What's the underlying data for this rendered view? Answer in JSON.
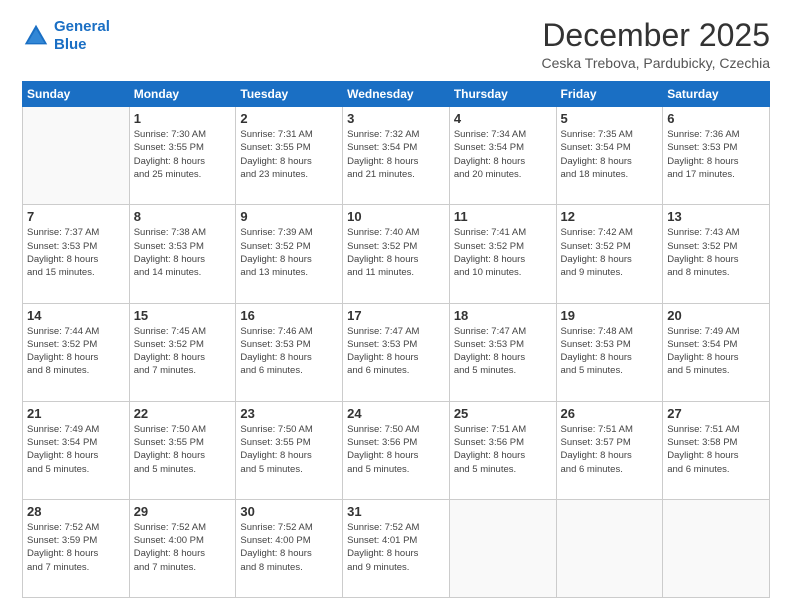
{
  "logo": {
    "line1": "General",
    "line2": "Blue"
  },
  "title": "December 2025",
  "subtitle": "Ceska Trebova, Pardubicky, Czechia",
  "weekdays": [
    "Sunday",
    "Monday",
    "Tuesday",
    "Wednesday",
    "Thursday",
    "Friday",
    "Saturday"
  ],
  "weeks": [
    [
      {
        "day": "",
        "info": ""
      },
      {
        "day": "1",
        "info": "Sunrise: 7:30 AM\nSunset: 3:55 PM\nDaylight: 8 hours\nand 25 minutes."
      },
      {
        "day": "2",
        "info": "Sunrise: 7:31 AM\nSunset: 3:55 PM\nDaylight: 8 hours\nand 23 minutes."
      },
      {
        "day": "3",
        "info": "Sunrise: 7:32 AM\nSunset: 3:54 PM\nDaylight: 8 hours\nand 21 minutes."
      },
      {
        "day": "4",
        "info": "Sunrise: 7:34 AM\nSunset: 3:54 PM\nDaylight: 8 hours\nand 20 minutes."
      },
      {
        "day": "5",
        "info": "Sunrise: 7:35 AM\nSunset: 3:54 PM\nDaylight: 8 hours\nand 18 minutes."
      },
      {
        "day": "6",
        "info": "Sunrise: 7:36 AM\nSunset: 3:53 PM\nDaylight: 8 hours\nand 17 minutes."
      }
    ],
    [
      {
        "day": "7",
        "info": "Sunrise: 7:37 AM\nSunset: 3:53 PM\nDaylight: 8 hours\nand 15 minutes."
      },
      {
        "day": "8",
        "info": "Sunrise: 7:38 AM\nSunset: 3:53 PM\nDaylight: 8 hours\nand 14 minutes."
      },
      {
        "day": "9",
        "info": "Sunrise: 7:39 AM\nSunset: 3:52 PM\nDaylight: 8 hours\nand 13 minutes."
      },
      {
        "day": "10",
        "info": "Sunrise: 7:40 AM\nSunset: 3:52 PM\nDaylight: 8 hours\nand 11 minutes."
      },
      {
        "day": "11",
        "info": "Sunrise: 7:41 AM\nSunset: 3:52 PM\nDaylight: 8 hours\nand 10 minutes."
      },
      {
        "day": "12",
        "info": "Sunrise: 7:42 AM\nSunset: 3:52 PM\nDaylight: 8 hours\nand 9 minutes."
      },
      {
        "day": "13",
        "info": "Sunrise: 7:43 AM\nSunset: 3:52 PM\nDaylight: 8 hours\nand 8 minutes."
      }
    ],
    [
      {
        "day": "14",
        "info": "Sunrise: 7:44 AM\nSunset: 3:52 PM\nDaylight: 8 hours\nand 8 minutes."
      },
      {
        "day": "15",
        "info": "Sunrise: 7:45 AM\nSunset: 3:52 PM\nDaylight: 8 hours\nand 7 minutes."
      },
      {
        "day": "16",
        "info": "Sunrise: 7:46 AM\nSunset: 3:53 PM\nDaylight: 8 hours\nand 6 minutes."
      },
      {
        "day": "17",
        "info": "Sunrise: 7:47 AM\nSunset: 3:53 PM\nDaylight: 8 hours\nand 6 minutes."
      },
      {
        "day": "18",
        "info": "Sunrise: 7:47 AM\nSunset: 3:53 PM\nDaylight: 8 hours\nand 5 minutes."
      },
      {
        "day": "19",
        "info": "Sunrise: 7:48 AM\nSunset: 3:53 PM\nDaylight: 8 hours\nand 5 minutes."
      },
      {
        "day": "20",
        "info": "Sunrise: 7:49 AM\nSunset: 3:54 PM\nDaylight: 8 hours\nand 5 minutes."
      }
    ],
    [
      {
        "day": "21",
        "info": "Sunrise: 7:49 AM\nSunset: 3:54 PM\nDaylight: 8 hours\nand 5 minutes."
      },
      {
        "day": "22",
        "info": "Sunrise: 7:50 AM\nSunset: 3:55 PM\nDaylight: 8 hours\nand 5 minutes."
      },
      {
        "day": "23",
        "info": "Sunrise: 7:50 AM\nSunset: 3:55 PM\nDaylight: 8 hours\nand 5 minutes."
      },
      {
        "day": "24",
        "info": "Sunrise: 7:50 AM\nSunset: 3:56 PM\nDaylight: 8 hours\nand 5 minutes."
      },
      {
        "day": "25",
        "info": "Sunrise: 7:51 AM\nSunset: 3:56 PM\nDaylight: 8 hours\nand 5 minutes."
      },
      {
        "day": "26",
        "info": "Sunrise: 7:51 AM\nSunset: 3:57 PM\nDaylight: 8 hours\nand 6 minutes."
      },
      {
        "day": "27",
        "info": "Sunrise: 7:51 AM\nSunset: 3:58 PM\nDaylight: 8 hours\nand 6 minutes."
      }
    ],
    [
      {
        "day": "28",
        "info": "Sunrise: 7:52 AM\nSunset: 3:59 PM\nDaylight: 8 hours\nand 7 minutes."
      },
      {
        "day": "29",
        "info": "Sunrise: 7:52 AM\nSunset: 4:00 PM\nDaylight: 8 hours\nand 7 minutes."
      },
      {
        "day": "30",
        "info": "Sunrise: 7:52 AM\nSunset: 4:00 PM\nDaylight: 8 hours\nand 8 minutes."
      },
      {
        "day": "31",
        "info": "Sunrise: 7:52 AM\nSunset: 4:01 PM\nDaylight: 8 hours\nand 9 minutes."
      },
      {
        "day": "",
        "info": ""
      },
      {
        "day": "",
        "info": ""
      },
      {
        "day": "",
        "info": ""
      }
    ]
  ]
}
